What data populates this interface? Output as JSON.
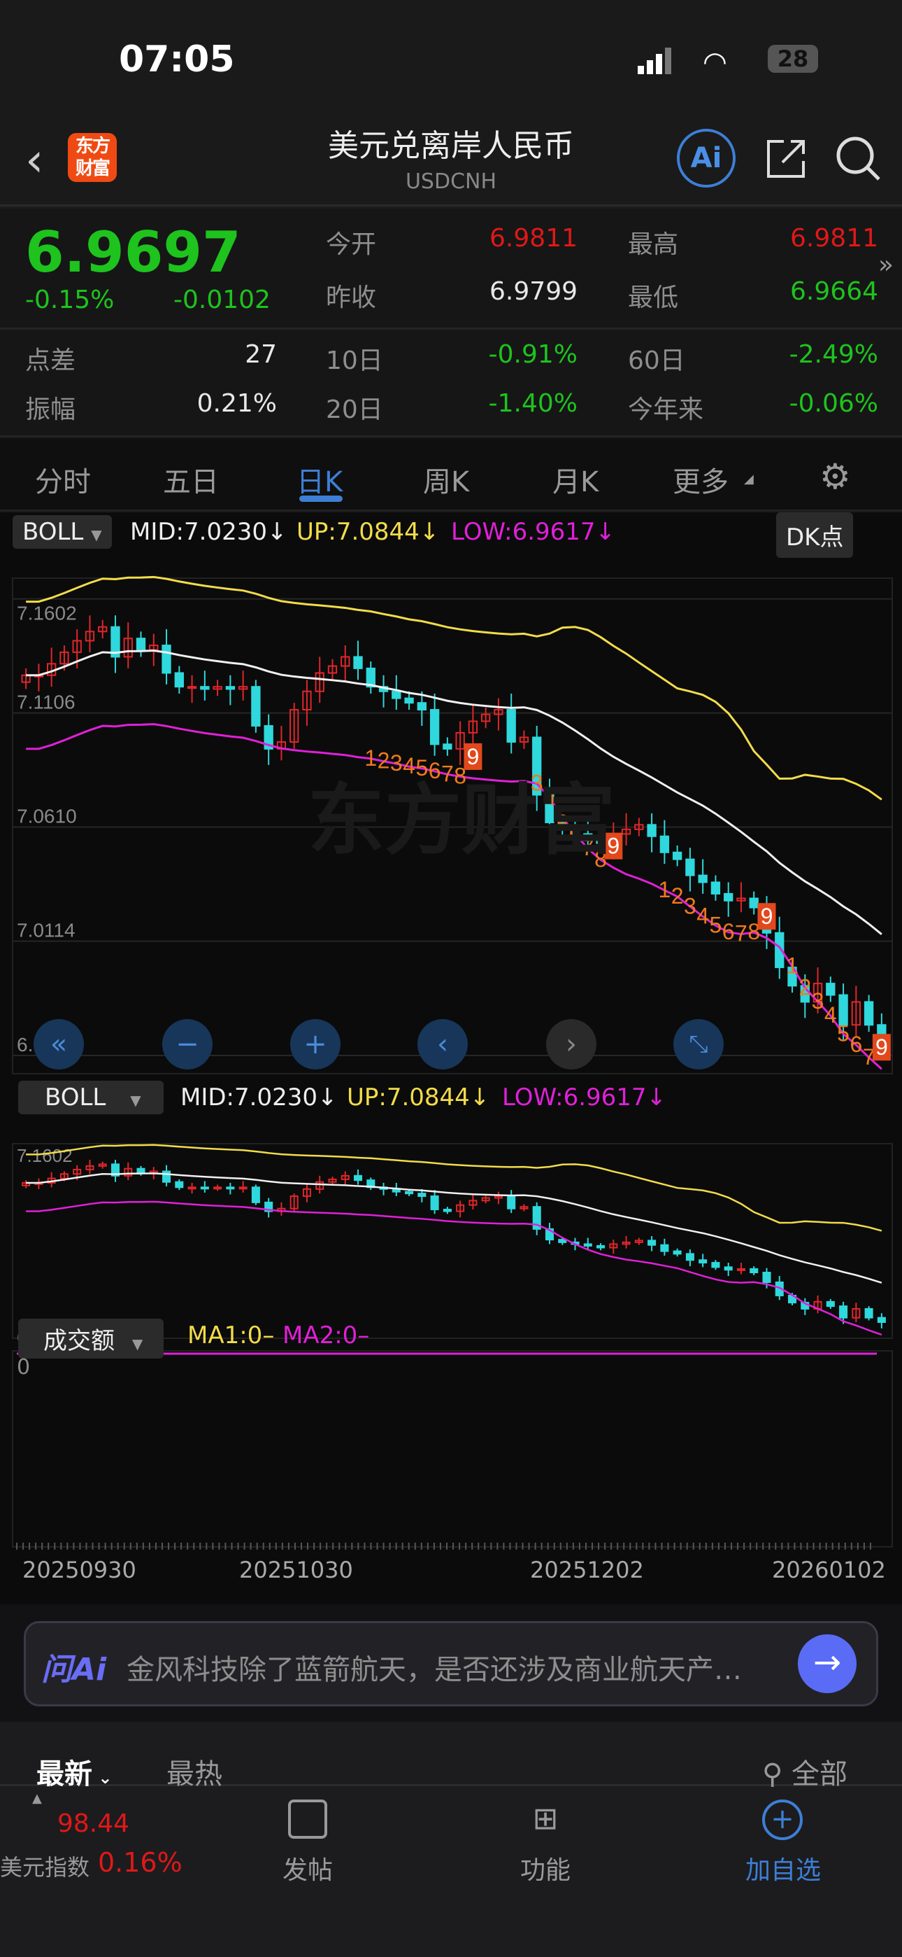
{
  "status": {
    "time": "07:05",
    "battery": "28"
  },
  "header": {
    "title": "美元兑离岸人民币",
    "code": "USDCNH",
    "logo_text": "东方财富",
    "ai_label": "Ai"
  },
  "quote": {
    "price": "6.9697",
    "change_pct": "-0.15%",
    "change": "-0.0102",
    "open_label": "今开",
    "open": "6.9811",
    "high_label": "最高",
    "high": "6.9811",
    "prev_label": "昨收",
    "prev": "6.9799",
    "low_label": "最低",
    "low": "6.9664",
    "spread_label": "点差",
    "spread": "27",
    "d10_label": "10日",
    "d10": "-0.91%",
    "d60_label": "60日",
    "d60": "-2.49%",
    "amp_label": "振幅",
    "amp": "0.21%",
    "d20_label": "20日",
    "d20": "-1.40%",
    "ytd_label": "今年来",
    "ytd": "-0.06%"
  },
  "tabs": [
    {
      "label": "分时"
    },
    {
      "label": "五日"
    },
    {
      "label": "日K",
      "active": true
    },
    {
      "label": "周K"
    },
    {
      "label": "月K"
    },
    {
      "label": "更多"
    }
  ],
  "indicator": {
    "name": "BOLL",
    "mid": "MID:7.0230",
    "up": "UP:7.0844",
    "low": "LOW:6.9617",
    "arrow": "↓",
    "dk": "DK点"
  },
  "indicator2": {
    "name": "BOLL",
    "mid": "MID:7.0230",
    "up": "UP:7.0844",
    "low": "LOW:6.9617",
    "arrow": "↓"
  },
  "volume": {
    "name": "成交额",
    "ma1": "MA1:0–",
    "ma2": "MA2:0–",
    "zero": "0"
  },
  "watermark": "东方财富",
  "colors": {
    "up": "#e0262a",
    "down": "#2ed8dc",
    "mid": "#f0f0f0",
    "upper": "#f2dc4a",
    "lower": "#e020d8",
    "accent": "#3d7fd6"
  },
  "chart_data": {
    "type": "candlestick",
    "ylim": [
      6.955,
      7.168
    ],
    "y_ticks": [
      "7.1602",
      "7.1106",
      "7.0610",
      "7.0114",
      "6.9617"
    ],
    "x_labels": [
      "20250930",
      "20251030",
      "20251202",
      "20260102"
    ],
    "first_open": 7.124,
    "closes": [
      7.127,
      7.127,
      7.132,
      7.137,
      7.142,
      7.146,
      7.148,
      7.135,
      7.143,
      7.138,
      7.14,
      7.128,
      7.122,
      7.122,
      7.121,
      7.122,
      7.121,
      7.122,
      7.105,
      7.095,
      7.098,
      7.112,
      7.12,
      7.128,
      7.131,
      7.135,
      7.13,
      7.122,
      7.12,
      7.117,
      7.115,
      7.112,
      7.097,
      7.095,
      7.102,
      7.107,
      7.11,
      7.112,
      7.098,
      7.1,
      7.075,
      7.063,
      7.06,
      7.058,
      7.056,
      7.054,
      7.058,
      7.06,
      7.062,
      7.057,
      7.05,
      7.047,
      7.04,
      7.037,
      7.032,
      7.029,
      7.03,
      7.026,
      7.015,
      7.0,
      6.992,
      6.985,
      6.993,
      6.988,
      6.975,
      6.985,
      6.975,
      6.97
    ],
    "td_marks": [
      {
        "i": 27,
        "t": "1"
      },
      {
        "i": 28,
        "t": "2"
      },
      {
        "i": 29,
        "t": "3"
      },
      {
        "i": 30,
        "t": "4"
      },
      {
        "i": 31,
        "t": "5"
      },
      {
        "i": 32,
        "t": "6"
      },
      {
        "i": 33,
        "t": "7"
      },
      {
        "i": 34,
        "t": "8"
      },
      {
        "i": 35,
        "t": "9"
      },
      {
        "i": 40,
        "t": "3"
      },
      {
        "i": 41,
        "t": "4"
      },
      {
        "i": 42,
        "t": "5"
      },
      {
        "i": 43,
        "t": "6"
      },
      {
        "i": 44,
        "t": "7"
      },
      {
        "i": 45,
        "t": "8"
      },
      {
        "i": 46,
        "t": "9"
      },
      {
        "i": 50,
        "t": "1"
      },
      {
        "i": 51,
        "t": "2"
      },
      {
        "i": 52,
        "t": "3"
      },
      {
        "i": 53,
        "t": "4"
      },
      {
        "i": 54,
        "t": "5"
      },
      {
        "i": 55,
        "t": "6"
      },
      {
        "i": 56,
        "t": "7"
      },
      {
        "i": 57,
        "t": "8"
      },
      {
        "i": 58,
        "t": "9"
      },
      {
        "i": 60,
        "t": "1"
      },
      {
        "i": 61,
        "t": "2"
      },
      {
        "i": 62,
        "t": "3"
      },
      {
        "i": 63,
        "t": "4"
      },
      {
        "i": 64,
        "t": "5"
      },
      {
        "i": 65,
        "t": "6"
      },
      {
        "i": 66,
        "t": "7"
      },
      {
        "i": 67,
        "t": "9"
      }
    ]
  },
  "chart_nav": [
    {
      "icon": "double-left"
    },
    {
      "icon": "zoom-out"
    },
    {
      "icon": "zoom-in"
    },
    {
      "icon": "left"
    },
    {
      "icon": "right"
    },
    {
      "icon": "fullscreen"
    }
  ],
  "ai_bar": {
    "label": "问Ai",
    "text": "金风科技除了蓝箭航天，是否还涉及商业航天产…"
  },
  "feed_tabs": {
    "latest": "最新",
    "hot": "最热",
    "filter": "全部"
  },
  "bottom_nav": {
    "index_value": "98.44",
    "index_name": "美元指数",
    "index_change": "0.16%",
    "post": "发帖",
    "functions": "功能",
    "add": "加自选"
  }
}
